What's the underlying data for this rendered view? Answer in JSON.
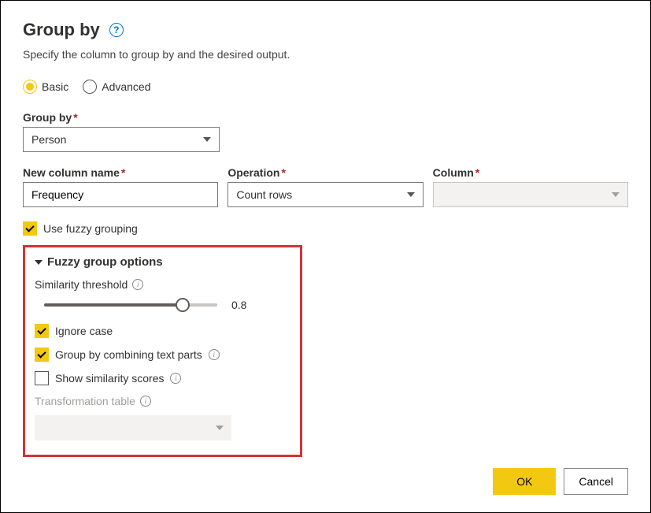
{
  "title": "Group by",
  "subtitle": "Specify the column to group by and the desired output.",
  "mode": {
    "basic": "Basic",
    "advanced": "Advanced"
  },
  "groupBy": {
    "label": "Group by",
    "value": "Person"
  },
  "newColumn": {
    "label": "New column name",
    "value": "Frequency"
  },
  "operation": {
    "label": "Operation",
    "value": "Count rows"
  },
  "column": {
    "label": "Column"
  },
  "fuzzyCheckbox": "Use fuzzy grouping",
  "fuzzySection": {
    "title": "Fuzzy group options",
    "similarityLabel": "Similarity threshold",
    "similarityValue": "0.8",
    "ignoreCase": "Ignore case",
    "combineTextParts": "Group by combining text parts",
    "showScores": "Show similarity scores",
    "transformTableLabel": "Transformation table"
  },
  "buttons": {
    "ok": "OK",
    "cancel": "Cancel"
  }
}
